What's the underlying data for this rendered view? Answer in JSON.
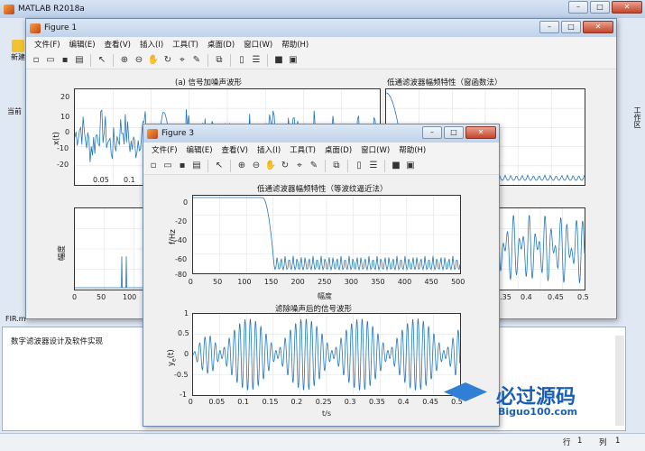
{
  "matlab": {
    "title": "MATLAB R2018a",
    "new_label": "新建",
    "current_label": "当前",
    "workspace_label": "工作区",
    "file_label": "FIR.m",
    "file_comment": "数字滤波器设计及软件实现",
    "status_row_label": "行",
    "status_row": "1",
    "status_col_label": "列",
    "status_col": "1"
  },
  "figure1": {
    "title": "Figure 1",
    "menu": [
      "文件(F)",
      "编辑(E)",
      "查看(V)",
      "插入(I)",
      "工具(T)",
      "桌面(D)",
      "窗口(W)",
      "帮助(H)"
    ],
    "plot1_title": "(a) 信号加噪声波形",
    "plot1_ylabel": "x(t)",
    "plot1_yticks": [
      "20",
      "10",
      "0",
      "-10",
      "-20"
    ],
    "plot1_xticks": [
      "0.05",
      "0.1"
    ],
    "plot2_title": "低通滤波器幅频特性（窗函数法）",
    "plot3_ylabel": "幅度",
    "plot3_xticks": [
      "0",
      "50",
      "100"
    ],
    "plot4_xticks": [
      "0.35",
      "0.4",
      "0.45",
      "0.5"
    ]
  },
  "figure3": {
    "title": "Figure 3",
    "menu": [
      "文件(F)",
      "编辑(E)",
      "查看(V)",
      "插入(I)",
      "工具(T)",
      "桌面(D)",
      "窗口(W)",
      "帮助(H)"
    ],
    "top_title": "低通滤波器幅频特性（等波纹逼近法）",
    "top_ylabel": "f/Hz",
    "top_xlabel": "幅度",
    "top_yticks": [
      "0",
      "-20",
      "-40",
      "-60",
      "-80"
    ],
    "top_xticks": [
      "0",
      "50",
      "100",
      "150",
      "200",
      "250",
      "300",
      "350",
      "400",
      "450",
      "500"
    ],
    "bot_title": "滤除噪声后的信号波形",
    "bot_ylabel": "y",
    "bot_ylabel_sub": "e",
    "bot_ylabel_suffix": "(t)",
    "bot_xlabel": "t/s",
    "bot_yticks": [
      "1",
      "0.5",
      "0",
      "-0.5",
      "-1"
    ],
    "bot_xticks": [
      "0",
      "0.05",
      "0.1",
      "0.15",
      "0.2",
      "0.25",
      "0.3",
      "0.35",
      "0.4",
      "0.45",
      "0.5"
    ]
  },
  "watermark": {
    "text": "必过源码",
    "url": "Biguo100.com"
  },
  "colors": {
    "line": "#2277bb",
    "title_bg": "#c8d9ee"
  }
}
